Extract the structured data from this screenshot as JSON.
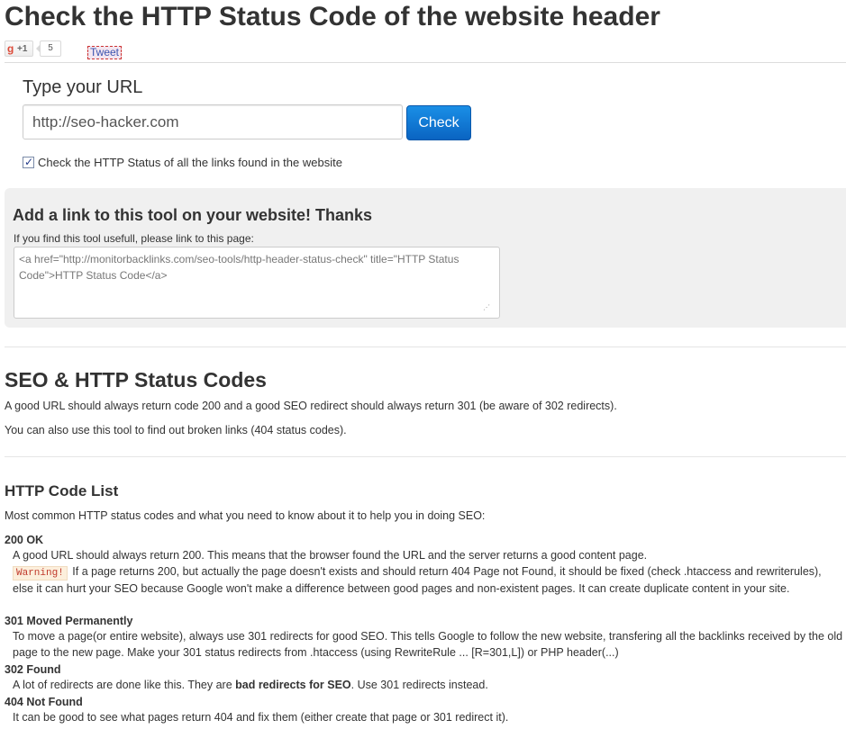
{
  "page": {
    "title": "Check the HTTP Status Code of the website header"
  },
  "social": {
    "gplus_icon": "g",
    "gplus_label": "+1",
    "gplus_count": "5",
    "tweet_label": "Tweet"
  },
  "form": {
    "label": "Type your URL",
    "url_value": "http://seo-hacker.com",
    "check_button": "Check",
    "checkbox_label": "Check the HTTP Status of all the links found in the website",
    "checkbox_checked": true
  },
  "link_box": {
    "title": "Add a link to this tool on your website! Thanks",
    "subtitle": "If you find this tool usefull, please link to this page:",
    "code": "<a href=\"http://monitorbacklinks.com/seo-tools/http-header-status-check\" title=\"HTTP Status Code\">HTTP Status Code</a>",
    "resize_grip": "⋰"
  },
  "seo_section": {
    "title": "SEO & HTTP Status Codes",
    "p1": "A good URL should always return code 200 and a good SEO redirect should always return 301 (be aware of 302 redirects).",
    "p2": "You can also use this tool to find out broken links (404 status codes)."
  },
  "code_list": {
    "title": "HTTP Code List",
    "intro": "Most common HTTP status codes and what you need to know about it to help you in doing SEO:",
    "c200": {
      "head": "200 OK",
      "desc1": "A good URL should always return 200. This means that the browser found the URL and the server returns a good content page.",
      "warning_badge": "Warning!",
      "warning_text": "If a page returns 200, but actually the page doesn't exists and should return 404 Page not Found, it should be fixed (check .htaccess and rewriterules), else it can hurt your SEO because Google won't make a difference between good pages and non-existent pages. It can create duplicate content in your site."
    },
    "c301": {
      "head": "301 Moved Permanently",
      "desc": "To move a page(or entire website), always use 301 redirects for good SEO. This tells Google to follow the new website, transfering all the backlinks received by the old page to the new page. Make your 301 status redirects from .htaccess (using RewriteRule ... [R=301,L]) or PHP header(...)"
    },
    "c302": {
      "head": "302 Found",
      "desc_a": "A lot of redirects are done like this. They are ",
      "desc_bold": "bad redirects for SEO",
      "desc_b": ". Use 301 redirects instead."
    },
    "c404": {
      "head": "404 Not Found",
      "desc": "It can be good to see what pages return 404 and fix them (either create that page or 301 redirect it)."
    }
  }
}
